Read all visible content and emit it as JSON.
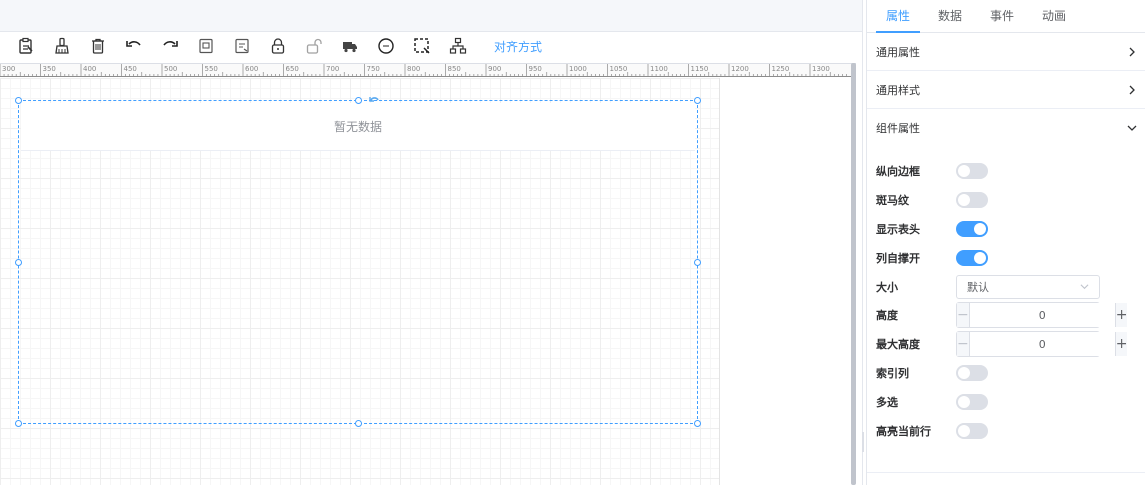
{
  "toolbar": {
    "align_label": "对齐方式",
    "buttons": [
      {
        "icon": "paste-icon"
      },
      {
        "icon": "brush-icon"
      },
      {
        "icon": "trash-icon"
      },
      {
        "icon": "undo-icon"
      },
      {
        "icon": "redo-icon"
      },
      {
        "icon": "import-icon"
      },
      {
        "icon": "export-icon"
      },
      {
        "icon": "lock-icon"
      },
      {
        "icon": "unlock-icon"
      },
      {
        "icon": "truck-icon"
      },
      {
        "icon": "ellipsis-circle-icon"
      },
      {
        "icon": "select-area-icon"
      },
      {
        "icon": "hierarchy-icon"
      }
    ]
  },
  "ruler": {
    "labels": [
      "300",
      "350",
      "400",
      "450",
      "500",
      "550",
      "600",
      "650",
      "700",
      "750",
      "800",
      "850",
      "900",
      "950",
      "1000",
      "1050",
      "1100",
      "1150",
      "1200",
      "1250",
      "1300"
    ]
  },
  "canvas": {
    "table_empty_text": "暂无数据"
  },
  "panel": {
    "tabs": [
      {
        "label": "属性",
        "active": true
      },
      {
        "label": "数据",
        "active": false
      },
      {
        "label": "事件",
        "active": false
      },
      {
        "label": "动画",
        "active": false
      }
    ],
    "sections": [
      {
        "title": "通用属性",
        "expanded": false
      },
      {
        "title": "通用样式",
        "expanded": false
      },
      {
        "title": "组件属性",
        "expanded": true
      }
    ],
    "props": {
      "vertical_border": {
        "label": "纵向边框",
        "on": false
      },
      "stripe": {
        "label": "斑马纹",
        "on": false
      },
      "show_header": {
        "label": "显示表头",
        "on": true
      },
      "fit_columns": {
        "label": "列自撑开",
        "on": true
      },
      "size": {
        "label": "大小",
        "value": "默认"
      },
      "height": {
        "label": "高度",
        "value": "0"
      },
      "max_height": {
        "label": "最大高度",
        "value": "0"
      },
      "index_column": {
        "label": "索引列",
        "on": false
      },
      "multi_select": {
        "label": "多选",
        "on": false
      },
      "highlight_current_row": {
        "label": "高亮当前行",
        "on": false
      }
    }
  },
  "colors": {
    "accent": "#409eff",
    "switch_off": "#dcdfe6"
  }
}
